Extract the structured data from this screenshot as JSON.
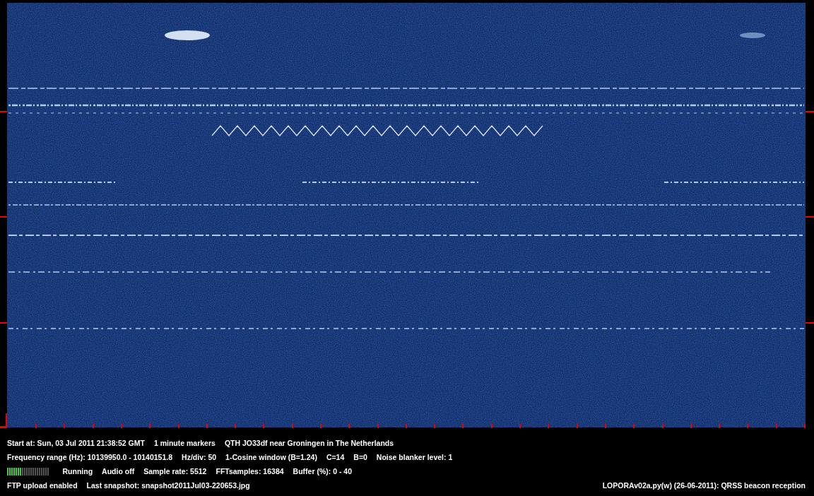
{
  "header_line": [
    "Start at: Sun, 03 Jul 2011 21:38:52 GMT",
    "1 minute markers",
    "QTH JO33df near Groningen in The Netherlands"
  ],
  "settings_line": [
    "Frequency range (Hz): 10139950.0 - 10140151.8",
    "Hz/div: 50",
    "1-Cosine window (B=1.24)",
    "C=14",
    "B=0",
    "Noise blanker level: 1"
  ],
  "status_line": {
    "buffer_meter": {
      "level": 0.35
    },
    "items": [
      "Running",
      "Audio off",
      "Sample rate: 5512",
      "FFTsamples: 16384",
      "Buffer (%): 0 - 40"
    ]
  },
  "footer_line": {
    "items": [
      "FTP upload enabled",
      "Last snapshot: snapshot2011Jul03-220653.jpg"
    ],
    "program": "LOPORAv02a.py(w) (26-06-2011): QRSS beacon reception"
  }
}
